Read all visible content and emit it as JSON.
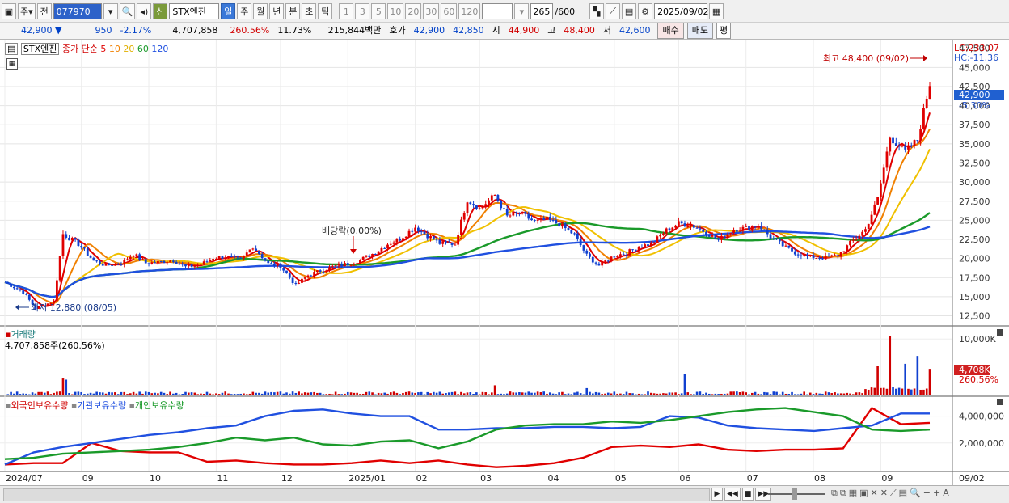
{
  "toolbar": {
    "period_type": "주",
    "prev_label": "전",
    "code": "077970",
    "new_badge": "신",
    "name": "STX엔진",
    "periods": [
      "일",
      "주",
      "월",
      "년",
      "분",
      "초",
      "틱"
    ],
    "active_period": "일",
    "intervals": [
      "1",
      "3",
      "5",
      "10",
      "20",
      "30",
      "60",
      "120"
    ],
    "count": "265",
    "count_max": "/600",
    "date": "2025/09/02"
  },
  "quote": {
    "price": "42,900",
    "arrow": "▼",
    "change": "950",
    "change_pct": "-2.17%",
    "volume": "4,707,858",
    "volume_ratio": "260.56%",
    "turnover": "11.73%",
    "amount": "215,844백만",
    "bid_label": "호가",
    "ask_price": "42,900",
    "bid_price": "42,850",
    "open_label": "시",
    "open": "44,900",
    "high_label": "고",
    "high": "48,400",
    "low_label": "저",
    "low": "42,600",
    "buy_label": "매수",
    "sell_label": "매도",
    "eval_label": "평"
  },
  "price_panel": {
    "stock_tag": "STX엔진",
    "ma_title": "종가 단순",
    "ma_periods": [
      "5",
      "10",
      "20",
      "60",
      "120"
    ],
    "ma_colors": [
      "#e00000",
      "#f08000",
      "#f0c000",
      "#1a9a2a",
      "#2050e0"
    ],
    "lc": "LC:233.07",
    "hc": "HC:-11.36",
    "y_ticks": [
      "45,000",
      "42,500",
      "40,000",
      "37,500",
      "35,000",
      "32,500",
      "30,000",
      "27,500",
      "25,000",
      "22,500",
      "20,000",
      "17,500",
      "15,000",
      "12,500"
    ],
    "y_top_partial": "47,500",
    "current_label": "42,900",
    "current_pct": "-5.30%",
    "high_annotation": "최고 48,400 (09/02)",
    "low_annotation": "최저 12,880 (08/05)",
    "dividend_annotation": "배당락(0.00%)"
  },
  "volume_panel": {
    "title": "거래량",
    "value": "4,707,858주(260.56%)",
    "y_ticks": [
      "10,000K"
    ],
    "current_label": "4,708K",
    "current_pct": "260.56%"
  },
  "holding_panel": {
    "series": [
      "외국인보유수량",
      "기관보유수량",
      "개인보유수량"
    ],
    "colors": [
      "#e00000",
      "#2050e0",
      "#1a9a2a"
    ],
    "y_ticks": [
      "4,000,000",
      "2,000,000"
    ]
  },
  "x_axis": {
    "labels": [
      "2024/07",
      "09",
      "10",
      "11",
      "12",
      "2025/01",
      "02",
      "03",
      "04",
      "05",
      "06",
      "07",
      "08",
      "09"
    ],
    "right_label": "09/02"
  },
  "chart_data": {
    "type": "candlestick",
    "period": "daily",
    "price_range": [
      11500,
      48000
    ],
    "points_price": [
      [
        0,
        16900
      ],
      [
        6,
        15600
      ],
      [
        10,
        13500
      ],
      [
        14,
        14100
      ],
      [
        16,
        14400
      ],
      [
        19,
        23200
      ],
      [
        24,
        21900
      ],
      [
        29,
        19700
      ],
      [
        33,
        19100
      ],
      [
        38,
        19400
      ],
      [
        42,
        20600
      ],
      [
        46,
        19400
      ],
      [
        50,
        19500
      ],
      [
        55,
        19800
      ],
      [
        59,
        18900
      ],
      [
        64,
        19200
      ],
      [
        68,
        20100
      ],
      [
        72,
        20200
      ],
      [
        77,
        19800
      ],
      [
        81,
        21600
      ],
      [
        86,
        19300
      ],
      [
        90,
        19000
      ],
      [
        95,
        16500
      ],
      [
        99,
        17800
      ],
      [
        103,
        18400
      ],
      [
        108,
        19000
      ],
      [
        112,
        19300
      ],
      [
        116,
        19800
      ],
      [
        121,
        20800
      ],
      [
        125,
        21900
      ],
      [
        129,
        22600
      ],
      [
        134,
        24100
      ],
      [
        138,
        23000
      ],
      [
        142,
        22000
      ],
      [
        147,
        21900
      ],
      [
        151,
        27700
      ],
      [
        155,
        26500
      ],
      [
        160,
        28300
      ],
      [
        164,
        25500
      ],
      [
        168,
        26000
      ],
      [
        173,
        24800
      ],
      [
        177,
        25100
      ],
      [
        181,
        24500
      ],
      [
        186,
        23100
      ],
      [
        190,
        20400
      ],
      [
        194,
        19100
      ],
      [
        199,
        20400
      ],
      [
        203,
        20700
      ],
      [
        207,
        21600
      ],
      [
        211,
        21900
      ],
      [
        216,
        23700
      ],
      [
        220,
        24600
      ],
      [
        224,
        24400
      ],
      [
        229,
        23400
      ],
      [
        233,
        22400
      ],
      [
        238,
        23800
      ],
      [
        242,
        24000
      ],
      [
        246,
        24400
      ],
      [
        250,
        22800
      ],
      [
        255,
        21400
      ],
      [
        259,
        20600
      ],
      [
        263,
        20200
      ],
      [
        268,
        20100
      ],
      [
        272,
        20400
      ],
      [
        276,
        22000
      ],
      [
        281,
        23800
      ],
      [
        285,
        27800
      ],
      [
        289,
        35900
      ],
      [
        294,
        34000
      ],
      [
        298,
        35500
      ],
      [
        302,
        42900
      ]
    ],
    "price_range_note": "x index spans 2024/07 to 2025/09/02",
    "volume_max_k": 10600,
    "volume_last_k": 4708,
    "holdings": {
      "foreign": [
        400000,
        500000,
        500000,
        2000000,
        1400000,
        1300000,
        1300000,
        600000,
        700000,
        500000,
        400000,
        400000,
        500000,
        700000,
        500000,
        700000,
        400000,
        200000,
        300000,
        500000,
        900000,
        1700000,
        1800000,
        1700000,
        1900000,
        1500000,
        1400000,
        1500000,
        1500000,
        1600000,
        4600000,
        3400000,
        3500000
      ],
      "institution": [
        400000,
        1300000,
        1700000,
        2000000,
        2300000,
        2600000,
        2800000,
        3100000,
        3300000,
        4000000,
        4400000,
        4500000,
        4200000,
        4000000,
        4000000,
        3000000,
        3000000,
        3100000,
        3100000,
        3200000,
        3200000,
        3100000,
        3200000,
        4000000,
        3900000,
        3300000,
        3100000,
        3000000,
        2900000,
        3100000,
        3300000,
        4200000,
        4200000
      ],
      "individual": [
        800000,
        900000,
        1200000,
        1300000,
        1400000,
        1500000,
        1700000,
        2000000,
        2400000,
        2200000,
        2400000,
        1900000,
        1800000,
        2100000,
        2200000,
        1600000,
        2100000,
        3000000,
        3300000,
        3400000,
        3400000,
        3600000,
        3500000,
        3700000,
        4000000,
        4300000,
        4500000,
        4600000,
        4300000,
        4000000,
        3000000,
        2900000,
        3000000
      ]
    }
  }
}
